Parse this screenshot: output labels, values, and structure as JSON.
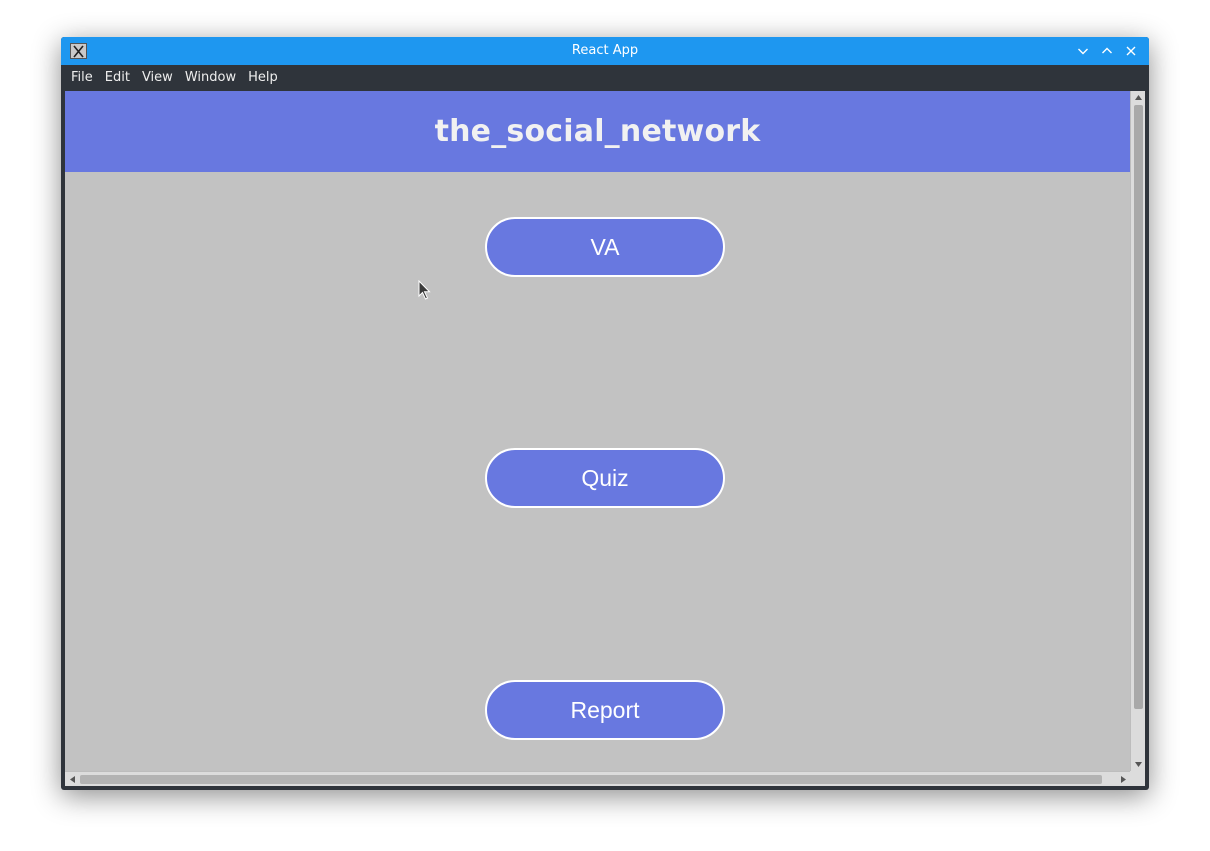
{
  "window": {
    "title": "React App",
    "app_icon": "x-app-icon",
    "controls": [
      "minimize-icon",
      "maximize-icon",
      "close-icon"
    ]
  },
  "menubar": {
    "items": [
      {
        "label": "File"
      },
      {
        "label": "Edit"
      },
      {
        "label": "View"
      },
      {
        "label": "Window"
      },
      {
        "label": "Help"
      }
    ]
  },
  "header": {
    "title": "the_social_network"
  },
  "nav": {
    "buttons": [
      {
        "label": "VA"
      },
      {
        "label": "Quiz"
      },
      {
        "label": "Report"
      }
    ]
  },
  "colors": {
    "titlebar": "#1e97f0",
    "menubar": "#2f343b",
    "accent": "#6878e0",
    "content_bg": "#c2c2c2",
    "button_border": "#ffffff"
  }
}
